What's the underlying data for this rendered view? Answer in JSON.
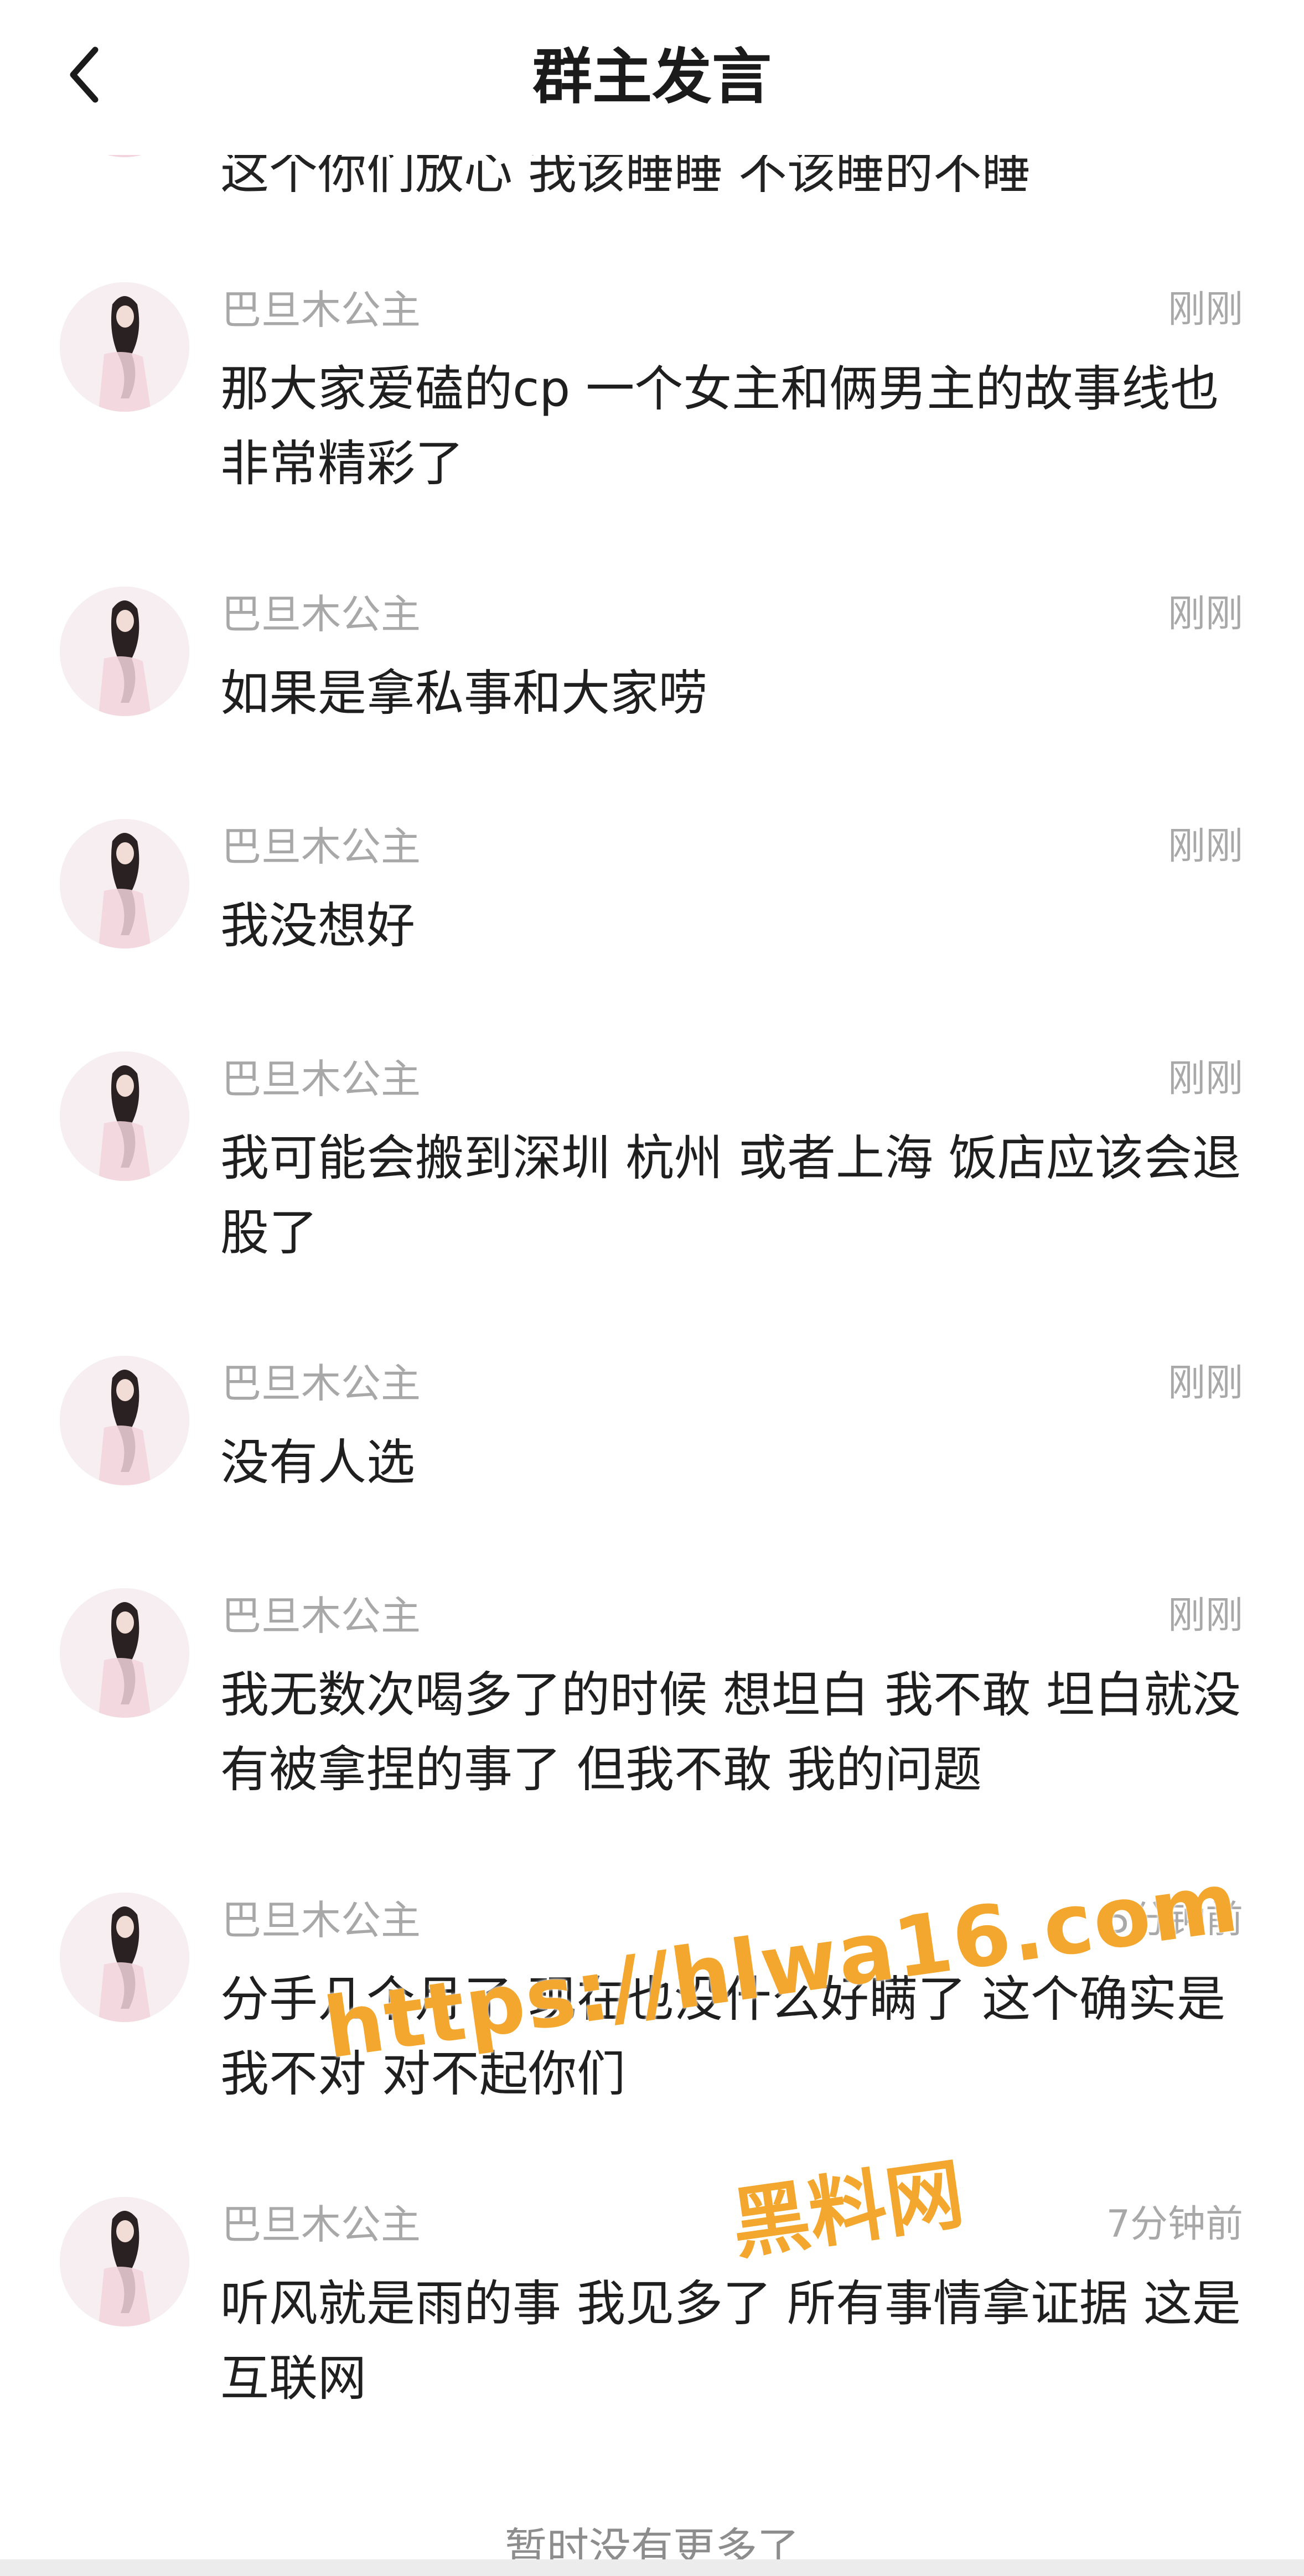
{
  "header": {
    "title": "群主发言",
    "back_icon": "chevron-left-icon"
  },
  "partial_message": {
    "text": "这个你们放心 我该睡睡 不该睡的不睡"
  },
  "messages": [
    {
      "name": "巴旦木公主",
      "time": "刚刚",
      "text": "那大家爱磕的cp 一个女主和俩男主的故事线也非常精彩了"
    },
    {
      "name": "巴旦木公主",
      "time": "刚刚",
      "text": "如果是拿私事和大家唠"
    },
    {
      "name": "巴旦木公主",
      "time": "刚刚",
      "text": "我没想好"
    },
    {
      "name": "巴旦木公主",
      "time": "刚刚",
      "text": "我可能会搬到深圳 杭州 或者上海 饭店应该会退股了"
    },
    {
      "name": "巴旦木公主",
      "time": "刚刚",
      "text": "没有人选"
    },
    {
      "name": "巴旦木公主",
      "time": "刚刚",
      "text": "我无数次喝多了的时候 想坦白 我不敢 坦白就没有被拿捏的事了 但我不敢 我的问题"
    },
    {
      "name": "巴旦木公主",
      "time": "5分钟前",
      "text": "分手几个月了 现在也没什么好瞒了 这个确实是我不对 对不起你们"
    },
    {
      "name": "巴旦木公主",
      "time": "7分钟前",
      "text": "听风就是雨的事 我见多了 所有事情拿证据 这是互联网"
    }
  ],
  "watermark": {
    "url": "https://hlwa16.com",
    "brand": "黑料网"
  },
  "footer": {
    "text": "暂时没有更多了"
  }
}
